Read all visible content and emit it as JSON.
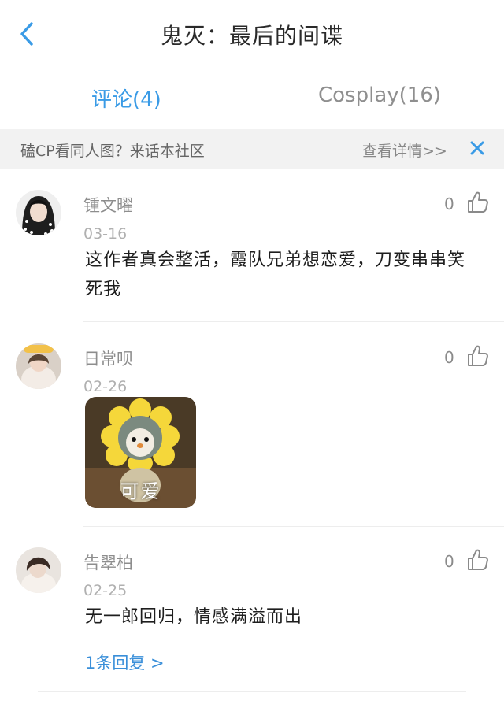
{
  "header": {
    "title": "鬼灭：最后的间谍"
  },
  "tabs": [
    {
      "label": "评论(4)",
      "active": true
    },
    {
      "label": "Cosplay(16)",
      "active": false
    }
  ],
  "banner": {
    "text": "磕CP看同人图？来话本社区",
    "link": "查看详情>>"
  },
  "comments": [
    {
      "username": "锺文曜",
      "date": "03-16",
      "text": "这作者真会整活，霞队兄弟想恋爱，刀变串串笑死我",
      "likes": "0"
    },
    {
      "username": "日常呗",
      "date": "02-26",
      "sticker_label": "可爱",
      "likes": "0"
    },
    {
      "username": "告翠柏",
      "date": "02-25",
      "text": "无一郎回归，情感满溢而出",
      "likes": "0",
      "replies": "1条回复 >"
    }
  ],
  "colors": {
    "accent": "#3a9be6",
    "banner_bg": "#f2f2f2"
  }
}
